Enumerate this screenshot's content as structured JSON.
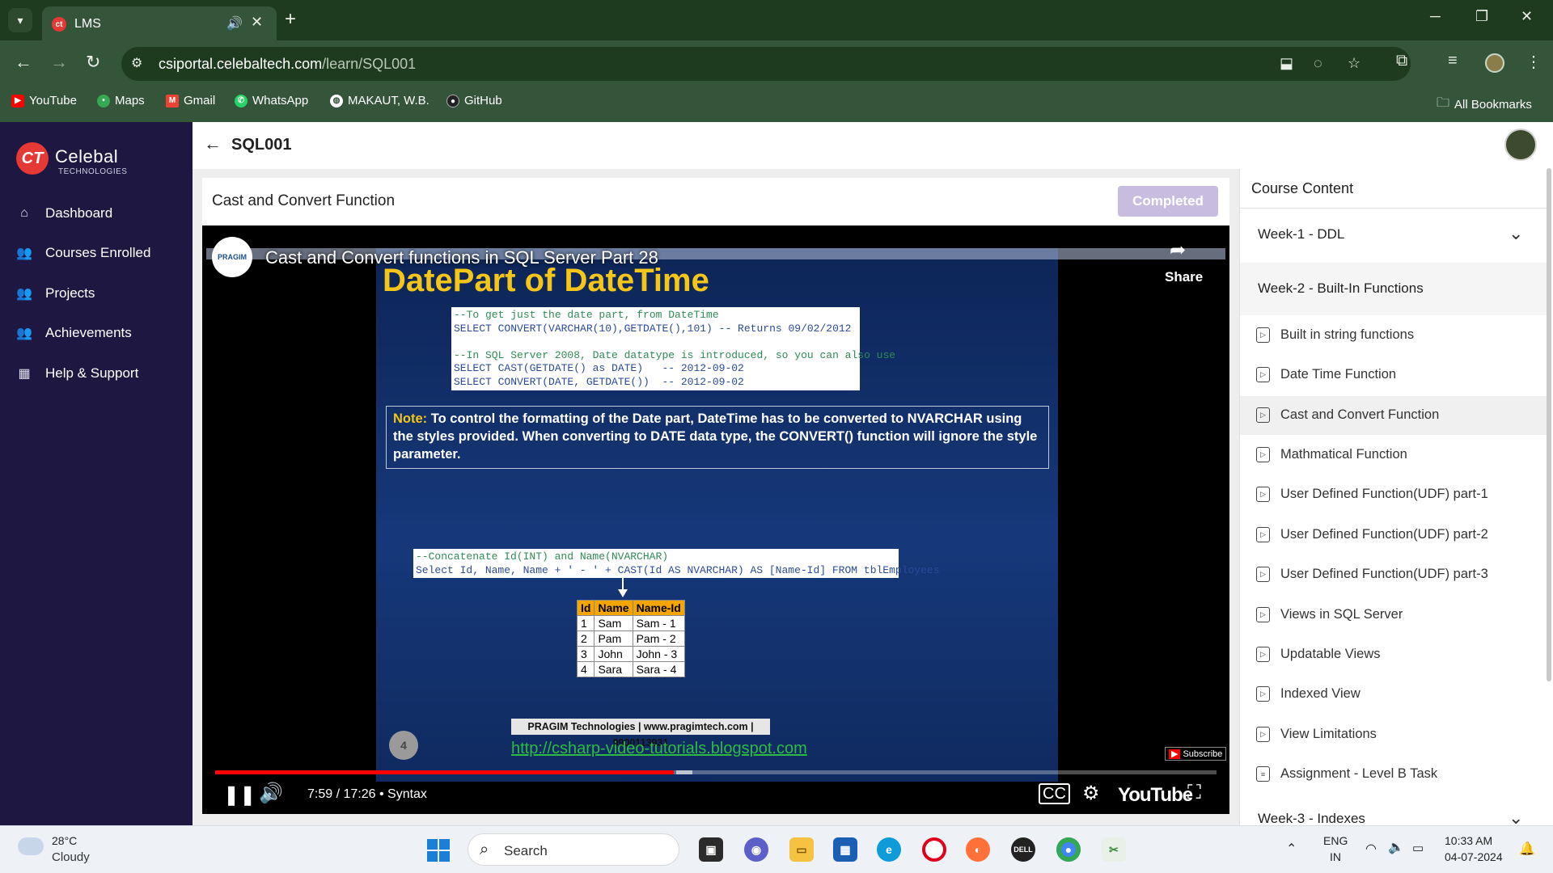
{
  "browser": {
    "tab_title": "LMS",
    "url_host": "csiportal.celebaltech.com",
    "url_path": "/learn/SQL001",
    "bookmarks": [
      "YouTube",
      "Maps",
      "Gmail",
      "WhatsApp",
      "MAKAUT, W.B.",
      "GitHub"
    ],
    "all_bookmarks": "All Bookmarks"
  },
  "brand": {
    "name": "Celebal",
    "sub": "TECHNOLOGIES",
    "mark": "CT"
  },
  "sidebar": {
    "items": [
      {
        "label": "Dashboard",
        "icon": "home-icon"
      },
      {
        "label": "Courses Enrolled",
        "icon": "people-icon"
      },
      {
        "label": "Projects",
        "icon": "people-icon"
      },
      {
        "label": "Achievements",
        "icon": "people-icon"
      },
      {
        "label": "Help & Support",
        "icon": "calendar-icon"
      }
    ]
  },
  "header": {
    "course_code": "SQL001"
  },
  "lesson": {
    "title": "Cast and Convert Function",
    "status_button": "Completed"
  },
  "video": {
    "title": "Cast and Convert functions in SQL Server Part 28",
    "channel_logo_text": "PRAGIM",
    "share_label": "Share",
    "slide_heading": "DatePart of DateTime",
    "code1": [
      "--To get just the date part, from DateTime",
      "SELECT CONVERT(VARCHAR(10),GETDATE(),101) -- Returns 09/02/2012",
      "",
      "--In SQL Server 2008, Date datatype is introduced, so you can also use",
      "SELECT CAST(GETDATE() as DATE)   -- 2012-09-02",
      "SELECT CONVERT(DATE, GETDATE())  -- 2012-09-02"
    ],
    "note_label": "Note:",
    "note_text": " To control the formatting of the Date part, DateTime has to be converted to NVARCHAR using the styles provided. When converting to DATE data type, the CONVERT() function will ignore the style parameter.",
    "code2": [
      "--Concatenate Id(INT) and Name(NVARCHAR)",
      "Select Id, Name, Name + ' - ' + CAST(Id AS NVARCHAR) AS [Name-Id] FROM tblEmployees"
    ],
    "result_headers": [
      "Id",
      "Name",
      "Name-Id"
    ],
    "result_rows": [
      [
        "1",
        "Sam",
        "Sam - 1"
      ],
      [
        "2",
        "Pam",
        "Pam - 2"
      ],
      [
        "3",
        "John",
        "John - 3"
      ],
      [
        "4",
        "Sara",
        "Sara - 4"
      ]
    ],
    "footer_text": "PRAGIM Technologies | www.pragimtech.com | 9900113931",
    "footer_link": "http://csharp-video-tutorials.blogspot.com",
    "slide_number": "4",
    "subscribe": "Subscribe",
    "time": "7:59 / 17:26",
    "chapter": "Syntax",
    "progress": 0.458,
    "yt_logo": "YouTube"
  },
  "course_content": {
    "title": "Course Content",
    "week1": "Week-1 - DDL",
    "week2": "Week-2 - Built-In Functions",
    "week3": "Week-3 - Indexes",
    "items": [
      "Built in string functions",
      "Date Time Function",
      "Cast and Convert Function",
      "Mathmatical Function",
      "User Defined Function(UDF) part-1",
      "User Defined Function(UDF) part-2",
      "User Defined Function(UDF) part-3",
      "Views in SQL Server",
      "Updatable Views",
      "Indexed View",
      "View Limitations",
      "Assignment - Level B Task"
    ]
  },
  "taskbar": {
    "temp": "28°C",
    "condition": "Cloudy",
    "search": "Search",
    "lang1": "ENG",
    "lang2": "IN",
    "time": "10:33 AM",
    "date": "04-07-2024"
  }
}
